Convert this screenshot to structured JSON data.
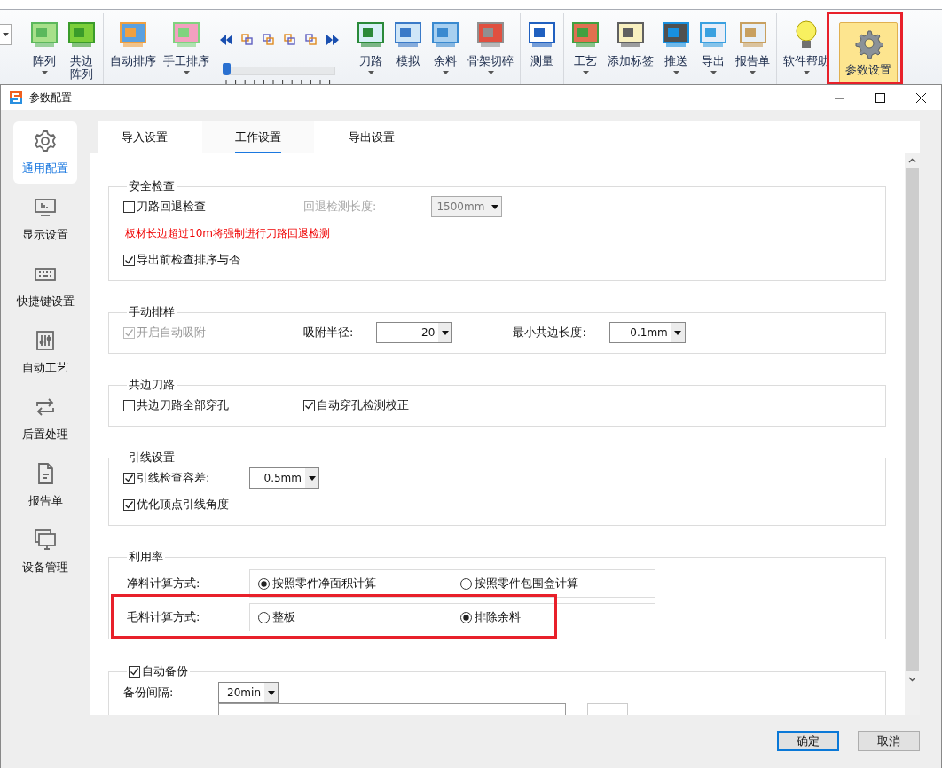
{
  "ribbon": {
    "groups": [
      {
        "items": [
          {
            "kind": "combo"
          },
          {
            "kind": "large",
            "lines": [
              "阵列"
            ],
            "dropdown": true,
            "selected": false,
            "highlighted": false
          },
          {
            "kind": "large",
            "lines": [
              "共边",
              "阵列"
            ],
            "selected": false,
            "highlighted": false
          }
        ]
      },
      {
        "items": [
          {
            "kind": "large",
            "lines": [
              "自动排序"
            ],
            "dropdown": false,
            "selected": false,
            "highlighted": false
          },
          {
            "kind": "large",
            "lines": [
              "手工排序"
            ],
            "dropdown": true,
            "selected": false,
            "highlighted": false
          },
          {
            "kind": "nav"
          },
          {
            "kind": "slider",
            "level": 0
          }
        ]
      },
      {
        "items": [
          {
            "kind": "large",
            "lines": [
              "刀路"
            ],
            "dropdown": true,
            "selected": false,
            "highlighted": false
          },
          {
            "kind": "large",
            "lines": [
              "模拟"
            ],
            "dropdown": false,
            "selected": false,
            "highlighted": false
          },
          {
            "kind": "large",
            "lines": [
              "余料"
            ],
            "dropdown": true,
            "selected": false,
            "highlighted": false
          },
          {
            "kind": "large",
            "lines": [
              "骨架切碎"
            ],
            "dropdown": true,
            "selected": false,
            "highlighted": false
          }
        ]
      },
      {
        "items": [
          {
            "kind": "large",
            "lines": [
              "测量"
            ],
            "dropdown": false,
            "selected": false,
            "highlighted": false
          }
        ]
      },
      {
        "items": [
          {
            "kind": "large",
            "lines": [
              "工艺"
            ],
            "dropdown": true,
            "selected": false,
            "highlighted": false
          },
          {
            "kind": "large",
            "lines": [
              "添加标签"
            ],
            "dropdown": false,
            "selected": false,
            "highlighted": false
          },
          {
            "kind": "large",
            "lines": [
              "推送"
            ],
            "dropdown": true,
            "selected": false,
            "highlighted": false
          },
          {
            "kind": "large",
            "lines": [
              "导出"
            ],
            "dropdown": true,
            "selected": false,
            "highlighted": false
          },
          {
            "kind": "large",
            "lines": [
              "报告单"
            ],
            "dropdown": true,
            "selected": false,
            "highlighted": false
          }
        ]
      },
      {
        "items": [
          {
            "kind": "large",
            "lines": [
              "软件帮助"
            ],
            "dropdown": true,
            "selected": false,
            "highlighted": false
          }
        ]
      },
      {
        "items": [
          {
            "kind": "large",
            "lines": [
              "参数设置"
            ],
            "selected": true,
            "highlighted": true
          }
        ]
      }
    ]
  },
  "dialog": {
    "title": "参数配置",
    "sidebar": [
      {
        "label": "通用配置",
        "selected": true
      },
      {
        "label": "显示设置",
        "selected": false
      },
      {
        "label": "快捷键设置",
        "selected": false
      },
      {
        "label": "自动工艺",
        "selected": false
      },
      {
        "label": "后置处理",
        "selected": false
      },
      {
        "label": "报告单",
        "selected": false
      },
      {
        "label": "设备管理",
        "selected": false
      }
    ],
    "tabs": [
      {
        "label": "导入设置",
        "selected": false
      },
      {
        "label": "工作设置",
        "selected": true
      },
      {
        "label": "导出设置",
        "selected": false
      }
    ],
    "sections": [
      {
        "title": {
          "kind": "text",
          "label": "安全检查"
        },
        "rows": [
          [
            {
              "kind": "checkbox",
              "label": "刀路回退检查",
              "checked": false,
              "disabled": false
            },
            {
              "kind": "label",
              "label": "回退检测长度:",
              "disabled": true
            },
            {
              "kind": "select",
              "value": "1500mm",
              "disabled": true
            }
          ],
          [
            {
              "kind": "note",
              "label": "板材长边超过10m将强制进行刀路回退检测"
            }
          ],
          [
            {
              "kind": "checkbox",
              "label": "导出前检查排序与否",
              "checked": true,
              "disabled": false
            }
          ]
        ]
      },
      {
        "title": {
          "kind": "text",
          "label": "手动排样"
        },
        "rows": [
          [
            {
              "kind": "checkbox",
              "label": "开启自动吸附",
              "checked": true,
              "disabled": true
            },
            {
              "kind": "label",
              "label": "吸附半径:",
              "disabled": false
            },
            {
              "kind": "select",
              "value": "20",
              "disabled": false
            },
            {
              "kind": "label",
              "label": "最小共边长度:",
              "disabled": false
            },
            {
              "kind": "select",
              "value": "0.1mm",
              "disabled": false
            }
          ]
        ]
      },
      {
        "title": {
          "kind": "text",
          "label": "共边刀路"
        },
        "rows": [
          [
            {
              "kind": "checkbox",
              "label": "共边刀路全部穿孔",
              "checked": false,
              "disabled": false
            },
            {
              "kind": "checkbox",
              "label": "自动穿孔检测校正",
              "checked": true,
              "disabled": false
            }
          ]
        ]
      },
      {
        "title": {
          "kind": "text",
          "label": "引线设置"
        },
        "rows": [
          [
            {
              "kind": "checkbox",
              "label": "引线检查容差:",
              "checked": true,
              "disabled": false
            },
            {
              "kind": "select",
              "value": "0.5mm",
              "disabled": false
            }
          ],
          [
            {
              "kind": "checkbox",
              "label": "优化顶点引线角度",
              "checked": true,
              "disabled": false
            }
          ]
        ]
      },
      {
        "title": {
          "kind": "text",
          "label": "利用率"
        },
        "rows": [
          [
            {
              "kind": "radios",
              "label": "净料计算方式:",
              "highlighted": false,
              "options": [
                {
                  "label": "按照零件净面积计算",
                  "selected": true
                },
                {
                  "label": "按照零件包围盒计算",
                  "selected": false
                }
              ]
            }
          ],
          [
            {
              "kind": "radios",
              "label": "毛料计算方式:",
              "highlighted": true,
              "options": [
                {
                  "label": "整板",
                  "selected": false
                },
                {
                  "label": "排除余料",
                  "selected": true
                }
              ]
            }
          ]
        ]
      },
      {
        "title": {
          "kind": "checkbox",
          "label": "自动备份",
          "checked": true
        },
        "rows": [
          [
            {
              "kind": "label",
              "label": "备份间隔:",
              "disabled": false
            },
            {
              "kind": "select",
              "value": "20min",
              "disabled": false
            }
          ],
          [
            {
              "kind": "partial"
            }
          ]
        ]
      }
    ],
    "buttons": [
      {
        "label": "确定",
        "default": true
      },
      {
        "label": "取消",
        "default": false
      }
    ]
  }
}
